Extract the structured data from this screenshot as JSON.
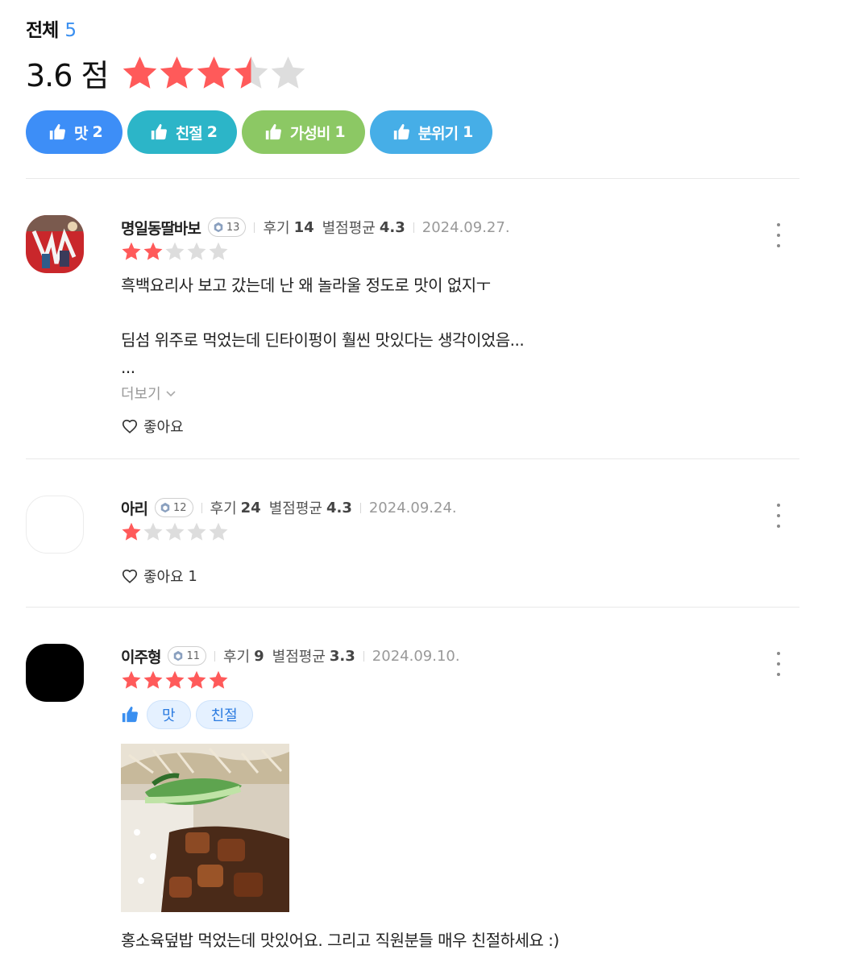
{
  "summary": {
    "label": "전체",
    "count": "5",
    "score": "3.6 점",
    "rating": 3.6
  },
  "keyword_chips": [
    {
      "label": "맛",
      "count": "2",
      "color": "#3d8ef7",
      "icon": "thumbs-up-icon"
    },
    {
      "label": "친절",
      "count": "2",
      "color": "#2cb5c8",
      "icon": "thumbs-up-icon"
    },
    {
      "label": "가성비",
      "count": "1",
      "color": "#8cc864",
      "icon": "thumbs-up-icon"
    },
    {
      "label": "분위기",
      "count": "1",
      "color": "#46aee7",
      "icon": "thumbs-up-icon"
    }
  ],
  "colors": {
    "star_filled": "#ff5a5a",
    "star_empty": "#dddddd",
    "accent_blue": "#3a8ff0"
  },
  "labels": {
    "reviews_word": "후기",
    "avg_word": "별점평균",
    "more": "더보기",
    "like": "좋아요"
  },
  "reviews": [
    {
      "nickname": "명일동딸바보",
      "level": "13",
      "review_count": "14",
      "avg_rating": "4.3",
      "date": "2024.09.27.",
      "stars": 2,
      "text": "흑백요리사 보고 갔는데 난 왜 놀라울 정도로 맛이 없지ㅜ\n\n딤섬 위주로 먹었는데 딘타이펑이 훨씬 맛있다는 생각이었음...\n...",
      "more": "더보기",
      "like": "좋아요",
      "like_count": ""
    },
    {
      "nickname": "아리",
      "level": "12",
      "review_count": "24",
      "avg_rating": "4.3",
      "date": "2024.09.24.",
      "stars": 1,
      "like": "좋아요",
      "like_count": "1"
    },
    {
      "nickname": "이주형",
      "level": "11",
      "review_count": "9",
      "avg_rating": "3.3",
      "date": "2024.09.10.",
      "stars": 5,
      "tags": [
        "맛",
        "친절"
      ],
      "text": "홍소육덮밥 먹었는데 맛있어요. 그리고 직원분들 매우 친절하세요 :)"
    }
  ]
}
